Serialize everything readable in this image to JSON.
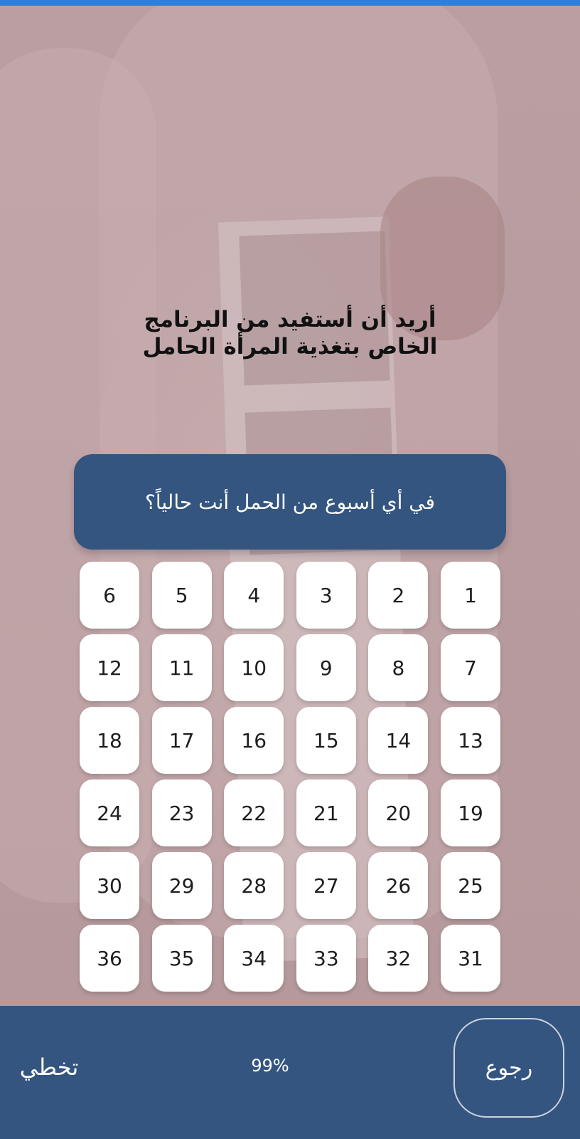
{
  "headline": "أريد أن أستفيد من البرنامج الخاص بتغذية المرأة الحامل",
  "question": "في أي أسبوع من الحمل أنت حالياً؟",
  "weeks": [
    "1",
    "2",
    "3",
    "4",
    "5",
    "6",
    "7",
    "8",
    "9",
    "10",
    "11",
    "12",
    "13",
    "14",
    "15",
    "16",
    "17",
    "18",
    "19",
    "20",
    "21",
    "22",
    "23",
    "24",
    "25",
    "26",
    "27",
    "28",
    "29",
    "30",
    "31",
    "32",
    "33",
    "34",
    "35",
    "36"
  ],
  "footer": {
    "back_label": "رجوع",
    "progress_text": "99%",
    "skip_label": "تخطي"
  },
  "colors": {
    "accent": "#2f7ed8",
    "primary": "#34557f",
    "background_tint": "#b49b9d"
  }
}
